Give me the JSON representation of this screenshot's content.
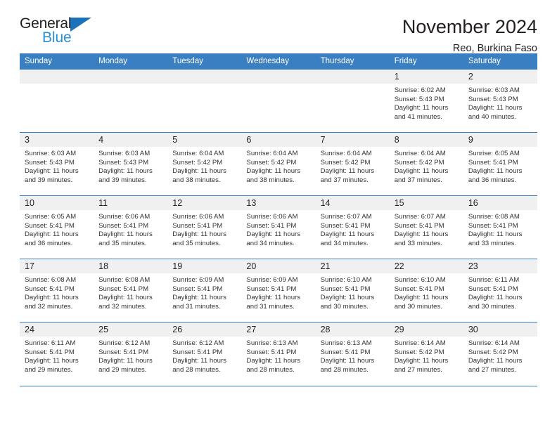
{
  "brand": {
    "name_part1": "General",
    "name_part2": "Blue",
    "accent_color": "#2a8fd4",
    "header_color": "#3a7fc1"
  },
  "header": {
    "title": "November 2024",
    "subtitle": "Reo, Burkina Faso"
  },
  "calendar": {
    "day_headers": [
      "Sunday",
      "Monday",
      "Tuesday",
      "Wednesday",
      "Thursday",
      "Friday",
      "Saturday"
    ],
    "weeks": [
      [
        {
          "day": "",
          "empty": true,
          "sunrise": "",
          "sunset": "",
          "daylight_line1": "",
          "daylight_line2": ""
        },
        {
          "day": "",
          "empty": true,
          "sunrise": "",
          "sunset": "",
          "daylight_line1": "",
          "daylight_line2": ""
        },
        {
          "day": "",
          "empty": true,
          "sunrise": "",
          "sunset": "",
          "daylight_line1": "",
          "daylight_line2": ""
        },
        {
          "day": "",
          "empty": true,
          "sunrise": "",
          "sunset": "",
          "daylight_line1": "",
          "daylight_line2": ""
        },
        {
          "day": "",
          "empty": true,
          "sunrise": "",
          "sunset": "",
          "daylight_line1": "",
          "daylight_line2": ""
        },
        {
          "day": "1",
          "empty": false,
          "sunrise": "Sunrise: 6:02 AM",
          "sunset": "Sunset: 5:43 PM",
          "daylight_line1": "Daylight: 11 hours",
          "daylight_line2": "and 41 minutes."
        },
        {
          "day": "2",
          "empty": false,
          "sunrise": "Sunrise: 6:03 AM",
          "sunset": "Sunset: 5:43 PM",
          "daylight_line1": "Daylight: 11 hours",
          "daylight_line2": "and 40 minutes."
        }
      ],
      [
        {
          "day": "3",
          "empty": false,
          "sunrise": "Sunrise: 6:03 AM",
          "sunset": "Sunset: 5:43 PM",
          "daylight_line1": "Daylight: 11 hours",
          "daylight_line2": "and 39 minutes."
        },
        {
          "day": "4",
          "empty": false,
          "sunrise": "Sunrise: 6:03 AM",
          "sunset": "Sunset: 5:43 PM",
          "daylight_line1": "Daylight: 11 hours",
          "daylight_line2": "and 39 minutes."
        },
        {
          "day": "5",
          "empty": false,
          "sunrise": "Sunrise: 6:04 AM",
          "sunset": "Sunset: 5:42 PM",
          "daylight_line1": "Daylight: 11 hours",
          "daylight_line2": "and 38 minutes."
        },
        {
          "day": "6",
          "empty": false,
          "sunrise": "Sunrise: 6:04 AM",
          "sunset": "Sunset: 5:42 PM",
          "daylight_line1": "Daylight: 11 hours",
          "daylight_line2": "and 38 minutes."
        },
        {
          "day": "7",
          "empty": false,
          "sunrise": "Sunrise: 6:04 AM",
          "sunset": "Sunset: 5:42 PM",
          "daylight_line1": "Daylight: 11 hours",
          "daylight_line2": "and 37 minutes."
        },
        {
          "day": "8",
          "empty": false,
          "sunrise": "Sunrise: 6:04 AM",
          "sunset": "Sunset: 5:42 PM",
          "daylight_line1": "Daylight: 11 hours",
          "daylight_line2": "and 37 minutes."
        },
        {
          "day": "9",
          "empty": false,
          "sunrise": "Sunrise: 6:05 AM",
          "sunset": "Sunset: 5:41 PM",
          "daylight_line1": "Daylight: 11 hours",
          "daylight_line2": "and 36 minutes."
        }
      ],
      [
        {
          "day": "10",
          "empty": false,
          "sunrise": "Sunrise: 6:05 AM",
          "sunset": "Sunset: 5:41 PM",
          "daylight_line1": "Daylight: 11 hours",
          "daylight_line2": "and 36 minutes."
        },
        {
          "day": "11",
          "empty": false,
          "sunrise": "Sunrise: 6:06 AM",
          "sunset": "Sunset: 5:41 PM",
          "daylight_line1": "Daylight: 11 hours",
          "daylight_line2": "and 35 minutes."
        },
        {
          "day": "12",
          "empty": false,
          "sunrise": "Sunrise: 6:06 AM",
          "sunset": "Sunset: 5:41 PM",
          "daylight_line1": "Daylight: 11 hours",
          "daylight_line2": "and 35 minutes."
        },
        {
          "day": "13",
          "empty": false,
          "sunrise": "Sunrise: 6:06 AM",
          "sunset": "Sunset: 5:41 PM",
          "daylight_line1": "Daylight: 11 hours",
          "daylight_line2": "and 34 minutes."
        },
        {
          "day": "14",
          "empty": false,
          "sunrise": "Sunrise: 6:07 AM",
          "sunset": "Sunset: 5:41 PM",
          "daylight_line1": "Daylight: 11 hours",
          "daylight_line2": "and 34 minutes."
        },
        {
          "day": "15",
          "empty": false,
          "sunrise": "Sunrise: 6:07 AM",
          "sunset": "Sunset: 5:41 PM",
          "daylight_line1": "Daylight: 11 hours",
          "daylight_line2": "and 33 minutes."
        },
        {
          "day": "16",
          "empty": false,
          "sunrise": "Sunrise: 6:08 AM",
          "sunset": "Sunset: 5:41 PM",
          "daylight_line1": "Daylight: 11 hours",
          "daylight_line2": "and 33 minutes."
        }
      ],
      [
        {
          "day": "17",
          "empty": false,
          "sunrise": "Sunrise: 6:08 AM",
          "sunset": "Sunset: 5:41 PM",
          "daylight_line1": "Daylight: 11 hours",
          "daylight_line2": "and 32 minutes."
        },
        {
          "day": "18",
          "empty": false,
          "sunrise": "Sunrise: 6:08 AM",
          "sunset": "Sunset: 5:41 PM",
          "daylight_line1": "Daylight: 11 hours",
          "daylight_line2": "and 32 minutes."
        },
        {
          "day": "19",
          "empty": false,
          "sunrise": "Sunrise: 6:09 AM",
          "sunset": "Sunset: 5:41 PM",
          "daylight_line1": "Daylight: 11 hours",
          "daylight_line2": "and 31 minutes."
        },
        {
          "day": "20",
          "empty": false,
          "sunrise": "Sunrise: 6:09 AM",
          "sunset": "Sunset: 5:41 PM",
          "daylight_line1": "Daylight: 11 hours",
          "daylight_line2": "and 31 minutes."
        },
        {
          "day": "21",
          "empty": false,
          "sunrise": "Sunrise: 6:10 AM",
          "sunset": "Sunset: 5:41 PM",
          "daylight_line1": "Daylight: 11 hours",
          "daylight_line2": "and 30 minutes."
        },
        {
          "day": "22",
          "empty": false,
          "sunrise": "Sunrise: 6:10 AM",
          "sunset": "Sunset: 5:41 PM",
          "daylight_line1": "Daylight: 11 hours",
          "daylight_line2": "and 30 minutes."
        },
        {
          "day": "23",
          "empty": false,
          "sunrise": "Sunrise: 6:11 AM",
          "sunset": "Sunset: 5:41 PM",
          "daylight_line1": "Daylight: 11 hours",
          "daylight_line2": "and 30 minutes."
        }
      ],
      [
        {
          "day": "24",
          "empty": false,
          "sunrise": "Sunrise: 6:11 AM",
          "sunset": "Sunset: 5:41 PM",
          "daylight_line1": "Daylight: 11 hours",
          "daylight_line2": "and 29 minutes."
        },
        {
          "day": "25",
          "empty": false,
          "sunrise": "Sunrise: 6:12 AM",
          "sunset": "Sunset: 5:41 PM",
          "daylight_line1": "Daylight: 11 hours",
          "daylight_line2": "and 29 minutes."
        },
        {
          "day": "26",
          "empty": false,
          "sunrise": "Sunrise: 6:12 AM",
          "sunset": "Sunset: 5:41 PM",
          "daylight_line1": "Daylight: 11 hours",
          "daylight_line2": "and 28 minutes."
        },
        {
          "day": "27",
          "empty": false,
          "sunrise": "Sunrise: 6:13 AM",
          "sunset": "Sunset: 5:41 PM",
          "daylight_line1": "Daylight: 11 hours",
          "daylight_line2": "and 28 minutes."
        },
        {
          "day": "28",
          "empty": false,
          "sunrise": "Sunrise: 6:13 AM",
          "sunset": "Sunset: 5:41 PM",
          "daylight_line1": "Daylight: 11 hours",
          "daylight_line2": "and 28 minutes."
        },
        {
          "day": "29",
          "empty": false,
          "sunrise": "Sunrise: 6:14 AM",
          "sunset": "Sunset: 5:42 PM",
          "daylight_line1": "Daylight: 11 hours",
          "daylight_line2": "and 27 minutes."
        },
        {
          "day": "30",
          "empty": false,
          "sunrise": "Sunrise: 6:14 AM",
          "sunset": "Sunset: 5:42 PM",
          "daylight_line1": "Daylight: 11 hours",
          "daylight_line2": "and 27 minutes."
        }
      ]
    ]
  }
}
